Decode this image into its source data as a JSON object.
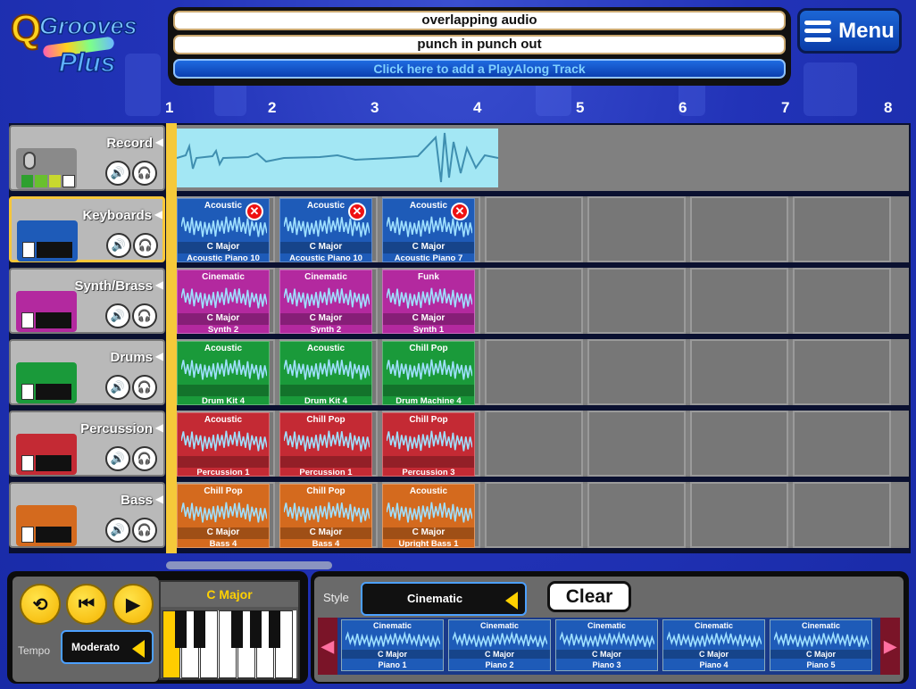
{
  "app": {
    "logo_q": "Q",
    "logo_text": "Grooves",
    "logo_sub": "Plus"
  },
  "header": {
    "line1": "overlapping audio",
    "line2": "punch in punch out",
    "line3": "Click here to add a PlayAlong Track"
  },
  "menu": {
    "label": "Menu"
  },
  "ruler": [
    "1",
    "2",
    "3",
    "4",
    "5",
    "6",
    "7",
    "8"
  ],
  "tracks": [
    {
      "name": "Record",
      "color": "#a3e7f4",
      "icon": "microphone-icon"
    },
    {
      "name": "Keyboards",
      "color": "#1e5bb8",
      "icon": "keyboard-icon"
    },
    {
      "name": "Synth/Brass",
      "color": "#b3299f",
      "icon": "synth-icon"
    },
    {
      "name": "Drums",
      "color": "#1a9a3a",
      "icon": "drums-icon"
    },
    {
      "name": "Percussion",
      "color": "#c42a34",
      "icon": "percussion-icon"
    },
    {
      "name": "Bass",
      "color": "#d46a1e",
      "icon": "bass-guitar-icon"
    }
  ],
  "clips": {
    "keyboards": [
      {
        "style": "Acoustic",
        "key": "C Major",
        "inst": "Acoustic Piano 10"
      },
      {
        "style": "Acoustic",
        "key": "C Major",
        "inst": "Acoustic Piano 10"
      },
      {
        "style": "Acoustic",
        "key": "C Major",
        "inst": "Acoustic Piano 7"
      }
    ],
    "synth": [
      {
        "style": "Cinematic",
        "key": "C Major",
        "inst": "Synth 2"
      },
      {
        "style": "Cinematic",
        "key": "C Major",
        "inst": "Synth 2"
      },
      {
        "style": "Funk",
        "key": "C Major",
        "inst": "Synth 1"
      }
    ],
    "drums": [
      {
        "style": "Acoustic",
        "key": "",
        "inst": "Drum Kit 4"
      },
      {
        "style": "Acoustic",
        "key": "",
        "inst": "Drum Kit 4"
      },
      {
        "style": "Chill Pop",
        "key": "",
        "inst": "Drum Machine 4"
      }
    ],
    "percussion": [
      {
        "style": "Acoustic",
        "key": "",
        "inst": "Percussion 1"
      },
      {
        "style": "Chill Pop",
        "key": "",
        "inst": "Percussion 1"
      },
      {
        "style": "Chill Pop",
        "key": "",
        "inst": "Percussion 3"
      }
    ],
    "bass": [
      {
        "style": "Chill Pop",
        "key": "C Major",
        "inst": "Bass 4"
      },
      {
        "style": "Chill Pop",
        "key": "C Major",
        "inst": "Bass 4"
      },
      {
        "style": "Acoustic",
        "key": "C Major",
        "inst": "Upright Bass 1"
      }
    ]
  },
  "transport": {
    "tempo_label": "Tempo",
    "tempo_value": "Moderato"
  },
  "key_selector": {
    "value": "C Major"
  },
  "style_selector": {
    "label": "Style",
    "value": "Cinematic"
  },
  "clear_label": "Clear",
  "picker": [
    {
      "style": "Cinematic",
      "key": "C Major",
      "inst": "Piano 1"
    },
    {
      "style": "Cinematic",
      "key": "C Major",
      "inst": "Piano 2"
    },
    {
      "style": "Cinematic",
      "key": "C Major",
      "inst": "Piano 3"
    },
    {
      "style": "Cinematic",
      "key": "C Major",
      "inst": "Piano 4"
    },
    {
      "style": "Cinematic",
      "key": "C Major",
      "inst": "Piano 5"
    }
  ]
}
